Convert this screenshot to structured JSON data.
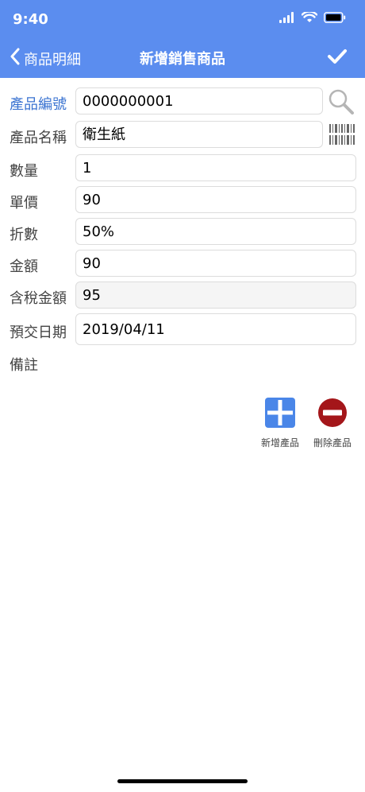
{
  "status_bar": {
    "time": "9:40"
  },
  "nav": {
    "back_label": "商品明細",
    "title": "新增銷售商品"
  },
  "form": {
    "product_code": {
      "label": "產品編號",
      "value": "0000000001"
    },
    "product_name": {
      "label": "產品名稱",
      "value": "衛生紙"
    },
    "quantity": {
      "label": "數量",
      "value": "1"
    },
    "unit_price": {
      "label": "單價",
      "value": "90"
    },
    "discount": {
      "label": "折數",
      "value": "50%"
    },
    "amount": {
      "label": "金額",
      "value": "90"
    },
    "amount_with_tax": {
      "label": "含稅金額",
      "value": "95"
    },
    "due_date": {
      "label": "預交日期",
      "value": "2019/04/11"
    },
    "remarks": {
      "label": "備註",
      "value": ""
    }
  },
  "actions": {
    "add_label": "新增產品",
    "delete_label": "刪除產品"
  },
  "colors": {
    "header": "#5b8def",
    "link": "#3a73d1",
    "add_button": "#4a86e8",
    "delete_button": "#a4161a"
  },
  "icons": [
    "chevron-left-icon",
    "checkmark-icon",
    "search-icon",
    "barcode-icon",
    "wifi-icon",
    "battery-icon",
    "signal-icon"
  ]
}
